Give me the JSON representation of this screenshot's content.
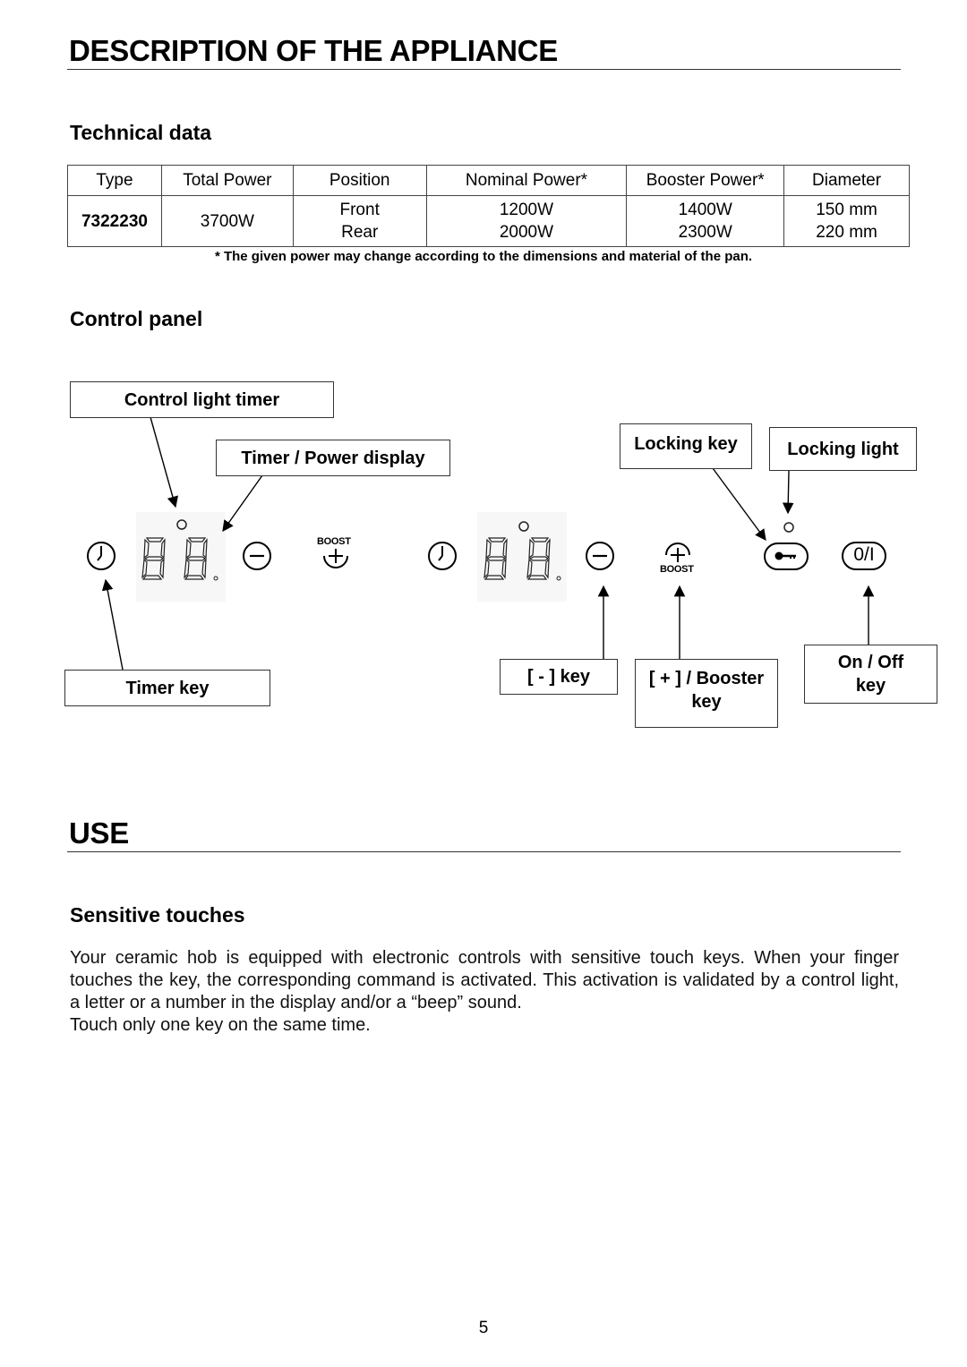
{
  "section1": {
    "title": "DESCRIPTION OF THE APPLIANCE",
    "technical_data": {
      "heading": "Technical data",
      "table": {
        "headers": [
          "Type",
          "Total Power",
          "Position",
          "Nominal Power*",
          "Booster Power*",
          "Diameter"
        ],
        "row": {
          "type": "7322230",
          "total_power": "3700W",
          "positions": [
            "Front",
            "Rear"
          ],
          "nominal_power": [
            "1200W",
            "2000W"
          ],
          "booster_power": [
            "1400W",
            "2300W"
          ],
          "diameter": [
            "150 mm",
            "220 mm"
          ]
        }
      },
      "footnote": "* The given power may change according to the dimensions and material of the pan."
    },
    "control_panel": {
      "heading": "Control panel",
      "callouts": {
        "control_light_timer": "Control light timer",
        "timer_power_display": "Timer / Power display",
        "locking_key": "Locking key",
        "locking_light": "Locking light",
        "timer_key": "Timer key",
        "minus_key": "[ - ] key",
        "plus_booster_key_line1": "[ + ] / Booster",
        "plus_booster_key_line2": "key",
        "on_off_key_line1": "On / Off",
        "on_off_key_line2": "key"
      },
      "panel_labels": {
        "boost": "BOOST",
        "on_off_symbol": "0/I"
      },
      "icons": [
        "clock-icon",
        "seven-segment-display",
        "minus-circle-icon",
        "plus-boost-icon",
        "key-lock-icon",
        "power-on-off-icon",
        "indicator-light"
      ]
    }
  },
  "section2": {
    "title": "USE",
    "sensitive_touches": {
      "heading": "Sensitive touches",
      "paragraph": "Your ceramic hob is equipped with electronic controls with sensitive touch keys. When your finger touches the key, the corresponding command is activated. This activation is validated by a control light, a letter or a number in the display and/or a “beep” sound.",
      "note": "Touch only one key on the same time."
    }
  },
  "page_number": "5"
}
